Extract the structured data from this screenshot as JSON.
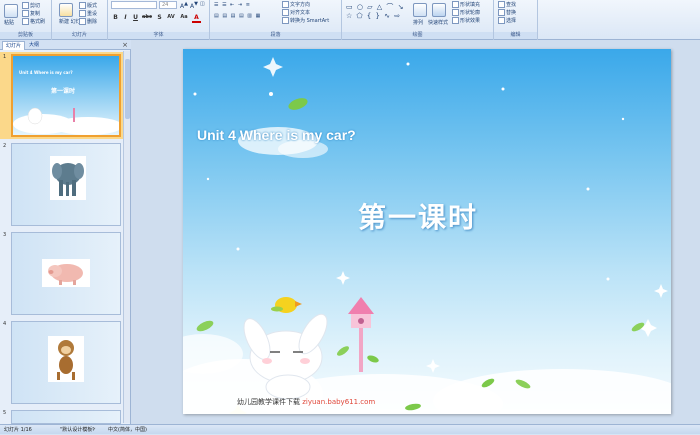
{
  "ribbon": {
    "clipboard": {
      "label": "剪贴板",
      "paste": "粘贴",
      "cut": "剪切",
      "copy": "复制",
      "format_painter": "格式刷"
    },
    "slides": {
      "label": "幻灯片",
      "new_slide": "新建\n幻灯片",
      "layout": "版式",
      "reset": "重设",
      "delete": "删除"
    },
    "font": {
      "label": "字体",
      "size": "24",
      "bold": "B",
      "italic": "I",
      "underline": "U",
      "strike": "abc",
      "shadow": "S",
      "spacing": "AV",
      "case": "Aa",
      "color": "A"
    },
    "paragraph": {
      "label": "段落",
      "text_direction": "文字方向",
      "align_text": "对齐文本",
      "smartart": "转换为 SmartArt"
    },
    "drawing": {
      "label": "绘图",
      "arrange": "排列",
      "quick_styles": "快速样式",
      "shape_fill": "形状填充",
      "shape_outline": "形状轮廓",
      "shape_effects": "形状效果"
    },
    "editing": {
      "label": "编辑",
      "find": "查找",
      "replace": "替换",
      "select": "选择"
    }
  },
  "panel": {
    "tab_slides": "幻灯片",
    "tab_outline": "大纲",
    "close": "×",
    "slides": [
      {
        "num": "1",
        "title": "第一课时",
        "subtitle": "Unit 4 Where is my car?"
      },
      {
        "num": "2",
        "picture": "elephant"
      },
      {
        "num": "3",
        "picture": "pig"
      },
      {
        "num": "4",
        "picture": "monkey"
      },
      {
        "num": "5",
        "picture": ""
      }
    ]
  },
  "slide": {
    "subtitle": "Unit 4 Where is my car?",
    "title": "第一课时",
    "credit_text": "幼儿园教学课件下载",
    "credit_url": "ziyuan.baby611.com"
  },
  "status": {
    "slide_counter": "幻灯片 1/16",
    "theme": "\"默认设计模板\"",
    "language": "中文(简体，中国)"
  }
}
